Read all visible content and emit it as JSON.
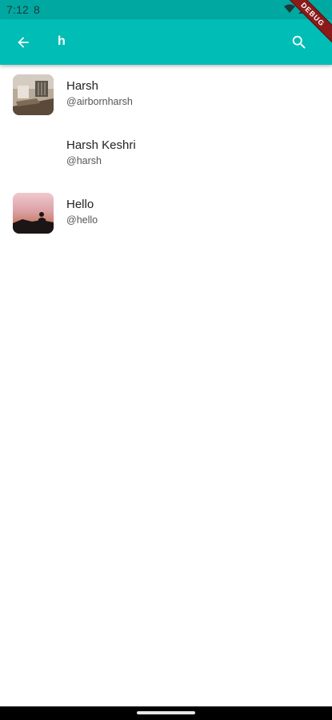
{
  "status_bar": {
    "time": "7:12",
    "sim_indicator": "8"
  },
  "debug_banner": "DEBUG",
  "app_bar": {
    "search_value": "h",
    "back_icon": "arrow-back-icon",
    "search_icon": "search-icon",
    "background_color": "#00bdb6"
  },
  "results": [
    {
      "name": "Harsh",
      "handle": "@airbornharsh",
      "avatar": "room-photo"
    },
    {
      "name": "Harsh Keshri",
      "handle": "@harsh",
      "avatar": "none"
    },
    {
      "name": "Hello",
      "handle": "@hello",
      "avatar": "sunset-photo"
    }
  ]
}
